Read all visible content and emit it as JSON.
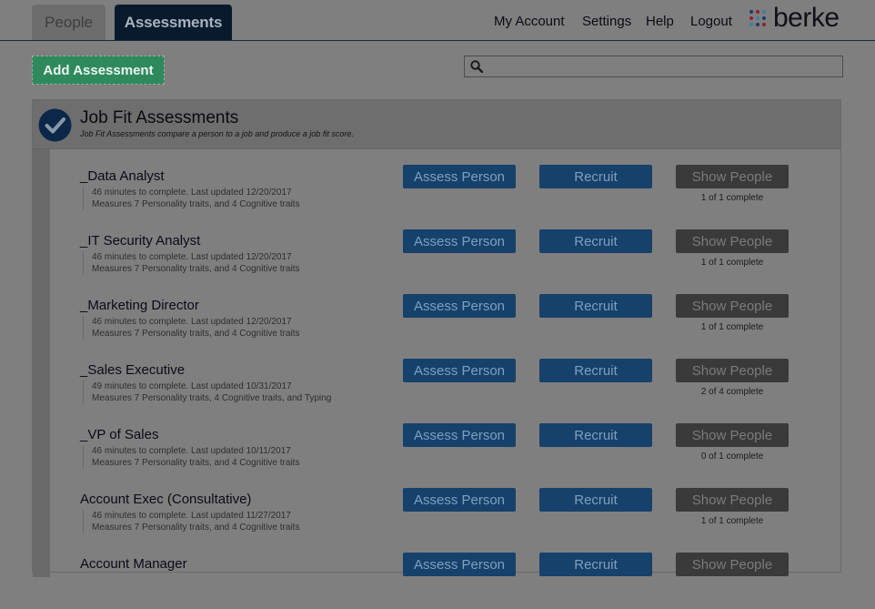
{
  "tabs": {
    "people": "People",
    "assessments": "Assessments"
  },
  "nav": {
    "my_account": "My Account",
    "settings": "Settings",
    "help": "Help",
    "logout": "Logout"
  },
  "brand": {
    "name": "berke",
    "dot_colors": [
      "#1b3a6e",
      "#8c2231",
      "#3a7fa8"
    ]
  },
  "toolbar": {
    "add_label": "Add Assessment",
    "search_placeholder": "",
    "search_value": ""
  },
  "colors": {
    "add_button": "#2e8a5c",
    "action_button": "#16416b",
    "show_button": "#3a3a3a",
    "check": "#0c2848"
  },
  "panel": {
    "title": "Job Fit Assessments",
    "subtitle": "Job Fit Assessments compare a person to a job and produce a job fit score.",
    "assess_label": "Assess Person",
    "recruit_label": "Recruit",
    "show_label": "Show People",
    "rows": [
      {
        "name": "_Data Analyst",
        "meta1": "46 minutes to complete. Last updated 12/20/2017",
        "meta2": "Measures 7 Personality traits, and 4 Cognitive traits",
        "count": "1 of 1 complete"
      },
      {
        "name": "_IT Security Analyst",
        "meta1": "46 minutes to complete. Last updated 12/20/2017",
        "meta2": "Measures 7 Personality traits, and 4 Cognitive traits",
        "count": "1 of 1 complete"
      },
      {
        "name": "_Marketing Director",
        "meta1": "46 minutes to complete. Last updated 12/20/2017",
        "meta2": "Measures 7 Personality traits, and 4 Cognitive traits",
        "count": "1 of 1 complete"
      },
      {
        "name": "_Sales Executive",
        "meta1": "49 minutes to complete. Last updated 10/31/2017",
        "meta2": "Measures 7 Personality traits, 4 Cognitive traits, and Typing",
        "count": "2 of 4 complete"
      },
      {
        "name": "_VP of Sales",
        "meta1": "46 minutes to complete. Last updated 10/11/2017",
        "meta2": "Measures 7 Personality traits, and 4 Cognitive traits",
        "count": "0 of 1 complete"
      },
      {
        "name": "Account Exec (Consultative)",
        "meta1": "46 minutes to complete. Last updated 11/27/2017",
        "meta2": "Measures 7 Personality traits, and 4 Cognitive traits",
        "count": "1 of 1 complete"
      },
      {
        "name": "Account Manager",
        "meta1": "",
        "meta2": "",
        "count": ""
      }
    ]
  }
}
